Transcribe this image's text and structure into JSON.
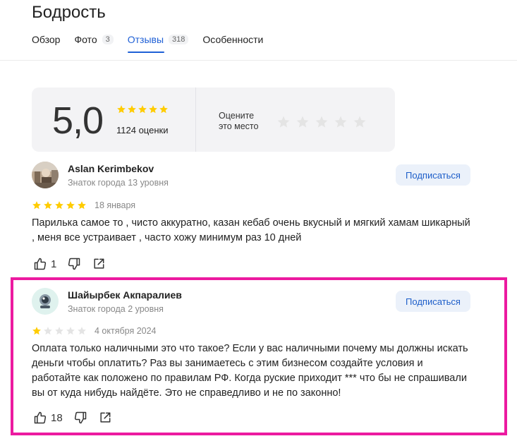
{
  "page": {
    "title": "Бодрость"
  },
  "tabs": [
    {
      "label": "Обзор",
      "count": ""
    },
    {
      "label": "Фото",
      "count": "3"
    },
    {
      "label": "Отзывы",
      "count": "318",
      "active": true
    },
    {
      "label": "Особенности",
      "count": ""
    }
  ],
  "rating_summary": {
    "score": "5,0",
    "stars": 5,
    "count_text": "1124 оценки",
    "rate_prompt_line1": "Оцените",
    "rate_prompt_line2": "это место"
  },
  "reviews": [
    {
      "author": "Aslan Kerimbekov",
      "level": "Знаток города 13 уровня",
      "subscribe_label": "Подписаться",
      "rating": 5,
      "date": "18 января",
      "text": "Парилька самое то , чисто аккуратно, казан кебаб очень вкусный и мягкий хамам шикарный , меня все устраивает , часто хожу минимум раз 10 дней",
      "likes": "1"
    },
    {
      "author": "Шайырбек Акпаралиев",
      "level": "Знаток города 2 уровня",
      "subscribe_label": "Подписаться",
      "rating": 1,
      "date": "4 октября 2024",
      "text": "Оплата только наличными это что такое? Если у вас наличными почему мы должны искать деньги чтобы оплатить? Раз вы занимаетесь с этим бизнесом создайте условия и работайте как положено по правилам РФ. Когда руские приходит *** что бы не спрашивали вы от куда нибудь найдёте. Это не справедливо и не по законно!",
      "likes": "18"
    }
  ],
  "colors": {
    "accent": "#1f60d6",
    "star_gold": "#ffcc00",
    "star_empty": "#e4e4e4",
    "highlight": "#ec1aa0"
  }
}
